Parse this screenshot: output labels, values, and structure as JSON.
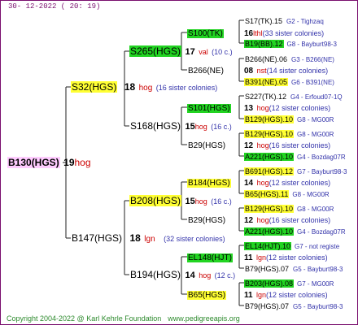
{
  "header": {
    "date": "30- 12-2022 ( 20: 19)"
  },
  "footer": {
    "copyright": "Copyright 2004-2022 @ Karl Kehrle Foundation",
    "website": "www.pedigreeapis.org"
  },
  "pedigree": {
    "root": {
      "name": "B130(HGS)",
      "num": "19",
      "tag": "hog"
    },
    "gen2": [
      {
        "name": "S32(HGS)",
        "num": "18",
        "tag": "hog",
        "note": "(16 sister colonies)"
      },
      {
        "name": "B147(HGS)",
        "num": "18",
        "tag": "lgn",
        "note": "(32 sister colonies)"
      }
    ],
    "gen3": [
      {
        "name": "S265(HGS)",
        "num": "17",
        "tag": "val",
        "note": "(10 c.)"
      },
      {
        "name": "S168(HGS)",
        "num": "15",
        "tag": "hog",
        "note": "(16 c.)"
      },
      {
        "name": "B208(HGS)",
        "num": "15",
        "tag": "hog",
        "note": "(16 c.)"
      },
      {
        "name": "B194(HGS)",
        "num": "14",
        "tag": "hog",
        "note": "(12 c.)"
      }
    ],
    "gen4": [
      {
        "name": "S100(TK)",
        "num": "16",
        "tag": "lthl",
        "note": "(33 sister colonies)"
      },
      {
        "name": "B266(NE)",
        "num": "08",
        "tag": "nst",
        "note": "(14 sister colonies)"
      },
      {
        "name": "S101(HGS)",
        "num": "13",
        "tag": "hog",
        "note": "(12 sister colonies)"
      },
      {
        "name": "B29(HGS)",
        "num": "12",
        "tag": "hog",
        "note": "(16 sister colonies)"
      },
      {
        "name": "B184(HGS)",
        "num": "14",
        "tag": "hog",
        "note": "(12 sister colonies)"
      },
      {
        "name": "B29(HGS)",
        "num": "12",
        "tag": "hog",
        "note": "(16 sister colonies)"
      },
      {
        "name": "EL148(HJT)",
        "num": "11",
        "tag": "lgn",
        "note": "(12 sister colonies)"
      },
      {
        "name": "B65(HGS)",
        "num": "11",
        "tag": "lgn",
        "note": "(12 sister colonies)"
      }
    ],
    "gen5": [
      {
        "name": "S17(TK).15",
        "loc": "G2 - Tighzaq"
      },
      {
        "name": "B19(BB).12",
        "loc": "G8 - Bayburt98-3"
      },
      {
        "name": "B266(NE).06",
        "loc": "G3 - B266(NE)"
      },
      {
        "name": "B391(NE).05",
        "loc": "G6 - B391(NE)"
      },
      {
        "name": "S227(TK).12",
        "loc": "G4 - Erfoud07-1Q"
      },
      {
        "name": "B129(HGS).10",
        "loc": "G8 - MG00R"
      },
      {
        "name": "B129(HGS).10",
        "loc": "G8 - MG00R"
      },
      {
        "name": "A221(HGS).10",
        "loc": "G4 - Bozdag07R"
      },
      {
        "name": "B691(HGS).12",
        "loc": "G7 - Bayburt98-3"
      },
      {
        "name": "B65(HGS).11",
        "loc": "G8 - MG00R"
      },
      {
        "name": "B129(HGS).10",
        "loc": "G8 - MG00R"
      },
      {
        "name": "A221(HGS).10",
        "loc": "G4 - Bozdag07R"
      },
      {
        "name": "EL14(HJT).10",
        "loc": "G7 - not registe"
      },
      {
        "name": "B79(HGS).07",
        "loc": "G5 - Bayburt98-3"
      },
      {
        "name": "B203(HGS).08",
        "loc": "G7 - MG00R"
      },
      {
        "name": "B79(HGS).07",
        "loc": "G5 - Bayburt98-3"
      }
    ]
  },
  "colors": {
    "green_highlight": "#22d422",
    "yellow_highlight": "#ffff33",
    "pink_highlight": "#ffccff",
    "frame": "#7a0f6e",
    "tag_red": "#cc0000",
    "note_blue": "#3333aa",
    "footer_green": "#2d8a2d"
  }
}
